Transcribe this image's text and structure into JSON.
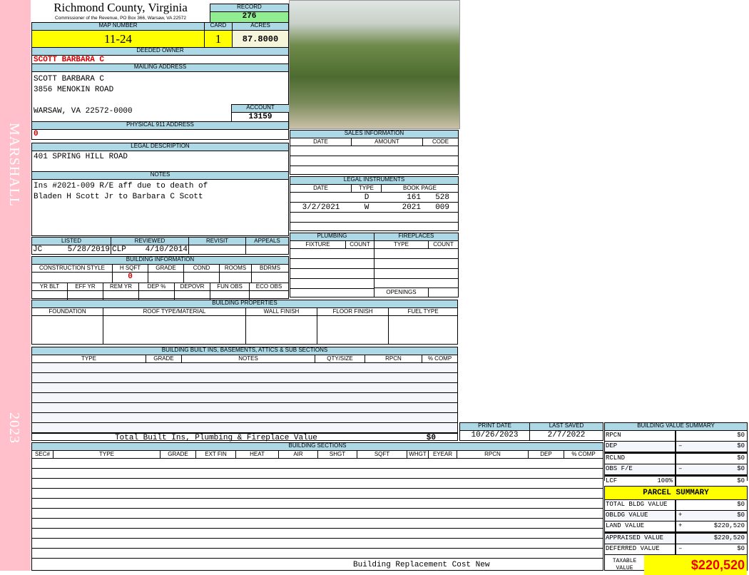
{
  "side": {
    "district": "MARSHALL",
    "year": "2023"
  },
  "header": {
    "title": "Richmond County, Virginia",
    "subtitle": "Commissioner of the Revenue, PO Box 366, Warsaw, VA 22572",
    "record_label": "RECORD",
    "record": "276"
  },
  "map": {
    "map_label": "MAP NUMBER",
    "map": "11-24",
    "card_label": "CARD",
    "card": "1",
    "acres_label": "ACRES",
    "acres": "87.8000"
  },
  "owner": {
    "label": "DEEDED OWNER",
    "value": "SCOTT BARBARA C"
  },
  "mailing": {
    "label": "MAILING ADDRESS",
    "line1": "SCOTT BARBARA C",
    "line2": "3856 MENOKIN ROAD",
    "line3": "WARSAW, VA 22572-0000",
    "account_label": "ACCOUNT",
    "account": "13159"
  },
  "physical": {
    "label": "PHYSICAL 911 ADDRESS",
    "value": "0"
  },
  "legal": {
    "label": "LEGAL DESCRIPTION",
    "value": "401 SPRING HILL ROAD"
  },
  "notes": {
    "label": "NOTES",
    "line1": "Ins #2021-009 R/E aff due to death of",
    "line2": "Bladen H Scott Jr to Barbara C Scott"
  },
  "review": {
    "listed_label": "LISTED",
    "listed_by": "JC",
    "listed_date": "5/28/2019",
    "reviewed_label": "REVIEWED",
    "reviewed_by": "CLP",
    "reviewed_date": "4/10/2014",
    "revisit_label": "REVISIT",
    "appeals_label": "APPEALS"
  },
  "building_info": {
    "label": "BUILDING INFORMATION",
    "h1": [
      "CONSTRUCTION STYLE",
      "H SQFT",
      "GRADE",
      "COND",
      "ROOMS",
      "BDRMS"
    ],
    "hsqft": "0",
    "h2": [
      "YR BLT",
      "EFF YR",
      "REM YR",
      "DEP %",
      "DEPOVR",
      "FUN OBS",
      "ECO OBS"
    ]
  },
  "sales": {
    "label": "SALES INFORMATION",
    "headers": [
      "DATE",
      "AMOUNT",
      "CODE"
    ]
  },
  "instruments": {
    "label": "LEGAL INSTRUMENTS",
    "headers": [
      "DATE",
      "TYPE",
      "BOOK PAGE"
    ],
    "rows": [
      {
        "date": "",
        "type": "D",
        "book": "161",
        "page": "528"
      },
      {
        "date": "3/2/2021",
        "type": "W",
        "book": "2021",
        "page": "009"
      }
    ]
  },
  "plumbing": {
    "label": "PLUMBING",
    "headers": [
      "FIXTURE",
      "COUNT"
    ]
  },
  "fireplaces": {
    "label": "FIREPLACES",
    "headers": [
      "TYPE",
      "COUNT"
    ],
    "openings": "OPENINGS"
  },
  "properties": {
    "label": "BUILDING PROPERTIES",
    "headers": [
      "FOUNDATION",
      "ROOF TYPE/MATERIAL",
      "WALL FINISH",
      "FLOOR FINISH",
      "FUEL TYPE"
    ]
  },
  "builtins": {
    "label": "BUILDING BUILT INS, BASEMENTS, ATTICS & SUB SECTIONS",
    "headers": [
      "TYPE",
      "GRADE",
      "NOTES",
      "QTY/SIZE",
      "RPCN",
      "% COMP"
    ],
    "total_label": "Total Built Ins, Plumbing & Fireplace Value",
    "total": "$0"
  },
  "dates": {
    "print_label": "PRINT DATE",
    "print": "10/26/2023",
    "saved_label": "LAST SAVED",
    "saved": "2/7/2022"
  },
  "sections": {
    "label": "BUILDING SECTIONS",
    "headers": [
      "SEC#",
      "TYPE",
      "GRADE",
      "EXT FIN",
      "HEAT",
      "AIR",
      "SHGT",
      "SQFT",
      "WHGT",
      "EYEAR",
      "RPCN",
      "DEP",
      "% COMP"
    ],
    "footer": "Building Replacement Cost New"
  },
  "value_summary": {
    "label": "BUILDING VALUE SUMMARY",
    "rows": [
      {
        "name": "RPCN",
        "op": "",
        "value": "$0"
      },
      {
        "name": "DEP",
        "op": "–",
        "value": "$0"
      },
      {
        "name": "RCLND",
        "op": "",
        "value": "$0"
      },
      {
        "name": "OBS F/E",
        "op": "–",
        "value": "$0"
      },
      {
        "name": "LCF",
        "pct": "100%",
        "op": "",
        "value": "$0"
      }
    ]
  },
  "parcel": {
    "title": "PARCEL SUMMARY",
    "rows": [
      {
        "name": "TOTAL BLDG VALUE",
        "op": "",
        "value": "$0"
      },
      {
        "name": "OBLDG VALUE",
        "op": "+",
        "value": "$0"
      },
      {
        "name": "LAND VALUE",
        "op": "+",
        "value": "$220,520"
      },
      {
        "name": "APPRAISED VALUE",
        "op": "",
        "value": "$220,520"
      },
      {
        "name": "DEFERRED VALUE",
        "op": "–",
        "value": "$0"
      }
    ],
    "taxable_label": "TAXABLE VALUE",
    "taxable": "$220,520"
  }
}
